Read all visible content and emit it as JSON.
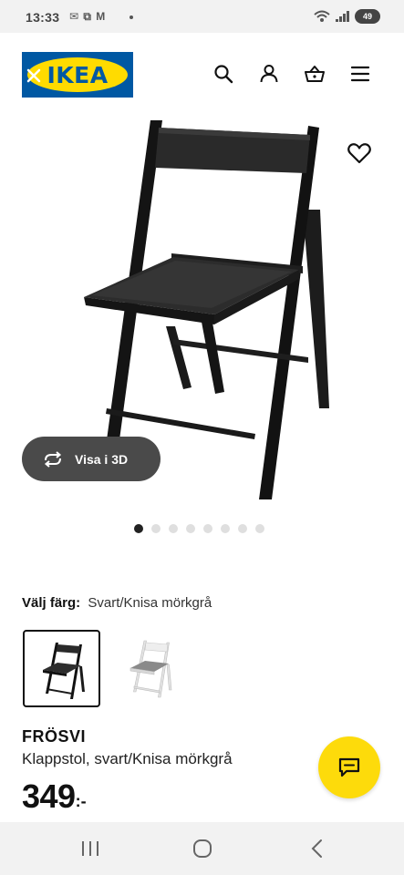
{
  "status_bar": {
    "time": "13:33",
    "left_icons": "✉ ⧉ M",
    "battery": "49"
  },
  "header": {
    "logo_text": "IKEA",
    "icons": [
      "search-icon",
      "profile-icon",
      "basket-icon",
      "menu-icon"
    ]
  },
  "product_gallery": {
    "view_3d_label": "Visa i 3D",
    "page_count": 8,
    "active_page": 1
  },
  "color_select": {
    "label": "Välj färg:",
    "value": "Svart/Knisa mörkgrå"
  },
  "product": {
    "name": "FRÖSVI",
    "description": "Klappstol, svart/Knisa mörkgrå",
    "price_integer": "349",
    "price_suffix": ":-"
  },
  "colors": {
    "accent_yellow": "#fddb0b",
    "brand_blue": "#0058a3",
    "brand_yellow": "#ffdb00"
  }
}
